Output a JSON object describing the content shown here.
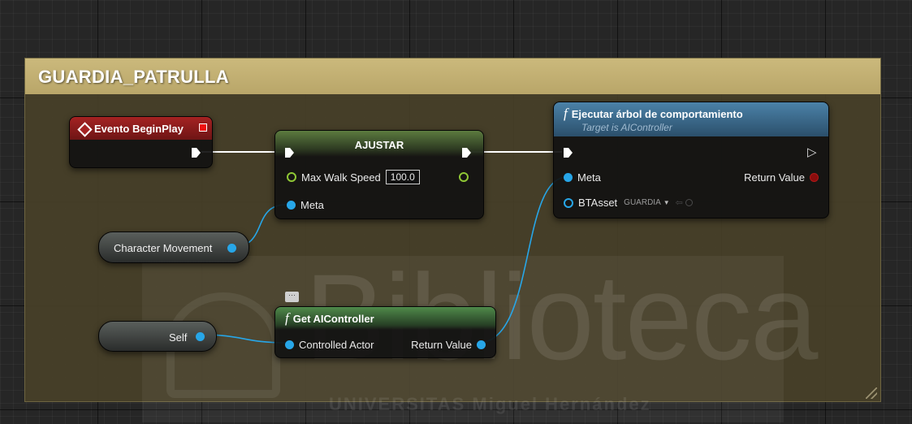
{
  "comment": {
    "title": "GUARDIA_PATRULLA"
  },
  "event_node": {
    "title": "Evento BeginPlay"
  },
  "set_node": {
    "title": "AJUSTAR",
    "pin_speed_label": "Max Walk Speed",
    "pin_speed_value": "100.0",
    "pin_target_label": "Meta"
  },
  "run_bt_node": {
    "func_glyph": "f",
    "title": "Ejecutar árbol de comportamiento",
    "subtitle": "Target is AIController",
    "pin_target_label": "Meta",
    "pin_return_label": "Return Value",
    "pin_btasset_label": "BTAsset",
    "pin_btasset_value": "GUARDIA"
  },
  "char_movement_node": {
    "label": "Character Movement"
  },
  "self_node": {
    "label": "Self"
  },
  "get_ai_node": {
    "func_glyph": "f",
    "title": "Get AIController",
    "pin_actor_label": "Controlled Actor",
    "pin_return_label": "Return Value"
  },
  "watermark": {
    "word": "Biblioteca",
    "sub": "UNIVERSITAS Miguel Hernández"
  },
  "colors": {
    "object_pin": "#27a6e8",
    "float_pin": "#8fc735",
    "event_header": "#8b1a1a",
    "function_header": "#3f7094",
    "comment_header": "#c4b274"
  }
}
